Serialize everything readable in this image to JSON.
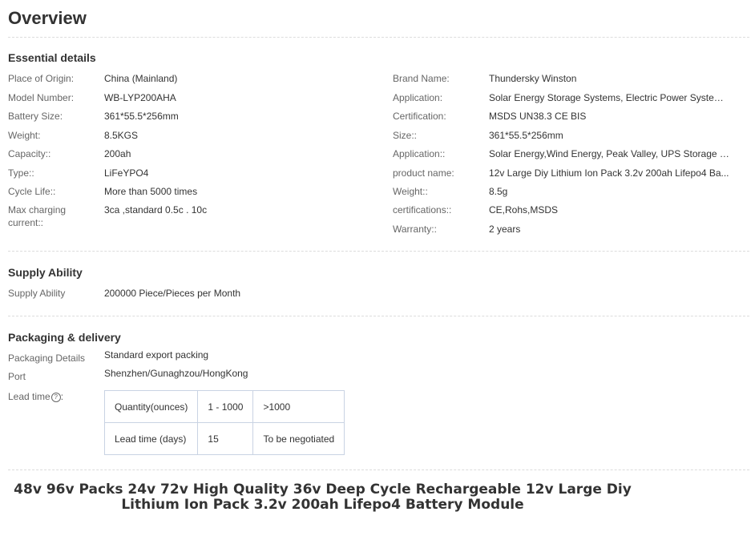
{
  "title": "Overview",
  "essential": {
    "heading": "Essential details",
    "left": [
      {
        "label": "Place of Origin:",
        "value": "China (Mainland)"
      },
      {
        "label": "Model Number:",
        "value": "WB-LYP200AHA"
      },
      {
        "label": "Battery Size:",
        "value": "361*55.5*256mm"
      },
      {
        "label": "Weight:",
        "value": "8.5KGS"
      },
      {
        "label": "Capacity::",
        "value": "200ah"
      },
      {
        "label": "Type::",
        "value": "LiFeYPO4"
      },
      {
        "label": "Cycle Life::",
        "value": "More than 5000 times"
      },
      {
        "label": "Max charging current::",
        "value": "3ca ,standard 0.5c . 10c"
      }
    ],
    "right": [
      {
        "label": "Brand Name:",
        "value": "Thundersky Winston"
      },
      {
        "label": "Application:",
        "value": "Solar Energy Storage Systems, Electric Power System..."
      },
      {
        "label": "Certification:",
        "value": "MSDS UN38.3 CE BIS"
      },
      {
        "label": "Size::",
        "value": "361*55.5*256mm"
      },
      {
        "label": "Application::",
        "value": "Solar Energy,Wind Energy, Peak Valley, UPS Storage , ..."
      },
      {
        "label": "product name:",
        "value": "12v Large Diy Lithium Ion Pack 3.2v 200ah Lifepo4 Ba..."
      },
      {
        "label": "Weight::",
        "value": "8.5g"
      },
      {
        "label": "certifications::",
        "value": "CE,Rohs,MSDS"
      },
      {
        "label": "Warranty::",
        "value": "2 years"
      }
    ]
  },
  "supply": {
    "heading": "Supply Ability",
    "label": "Supply Ability",
    "value": "200000 Piece/Pieces per Month"
  },
  "packaging": {
    "heading": "Packaging & delivery",
    "details_label": "Packaging Details",
    "details_value": "Standard export packing",
    "port_label": "Port",
    "port_value": "Shenzhen/Gunaghzou/HongKong",
    "lead_label": "Lead time",
    "help_icon": "question-circle-icon",
    "help_glyph": "?",
    "lead_colon": ":",
    "table": {
      "header": [
        "Quantity(ounces)",
        "1 - 1000",
        ">1000"
      ],
      "row": [
        "Lead time (days)",
        "15",
        "To be negotiated"
      ]
    }
  },
  "product_title": {
    "line1": "48v 96v Packs 24v 72v High Quality 36v Deep Cycle Rechargeable 12v Large Diy",
    "line2": "Lithium Ion Pack 3.2v 200ah Lifepo4 Battery Module"
  }
}
